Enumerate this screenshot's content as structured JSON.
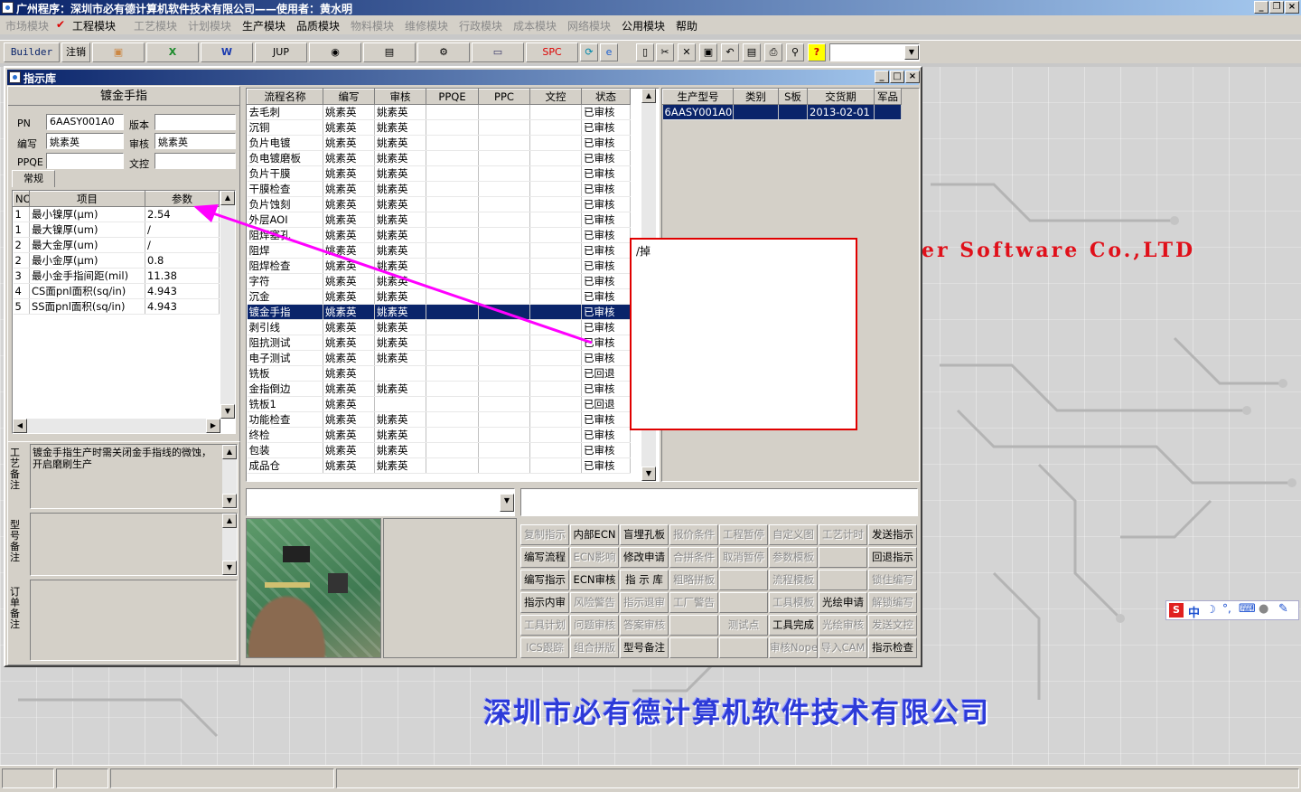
{
  "app": {
    "title": "广州程序：深圳市必有德计算机软件技术有限公司——使用者：黄水明",
    "background_tag": "er Software Co.,LTD",
    "background_company": "深圳市必有德计算机软件技术有限公司"
  },
  "menu": [
    {
      "label": "市场模块",
      "enabled": false
    },
    {
      "label": "工程模块",
      "enabled": true,
      "checked": true
    },
    {
      "label": "工艺模块",
      "enabled": false
    },
    {
      "label": "计划模块",
      "enabled": false
    },
    {
      "label": "生产模块",
      "enabled": true
    },
    {
      "label": "品质模块",
      "enabled": true
    },
    {
      "label": "物料模块",
      "enabled": false
    },
    {
      "label": "维修模块",
      "enabled": false
    },
    {
      "label": "行政模块",
      "enabled": false
    },
    {
      "label": "成本模块",
      "enabled": false
    },
    {
      "label": "网络模块",
      "enabled": false
    },
    {
      "label": "公用模块",
      "enabled": true
    },
    {
      "label": "帮助",
      "enabled": true
    }
  ],
  "toolbar": {
    "builder": "Builder",
    "logout": "注销",
    "jup": "JUP",
    "spc": "SPC",
    "help_glyph": "?"
  },
  "child": {
    "title": "指示库",
    "left": {
      "heading": "镀金手指",
      "pn_label": "PN",
      "pn_value": "6AASY001A0",
      "version_label": "版本",
      "version_value": "",
      "author_label": "编写",
      "author_value": "姚素英",
      "review_label": "审核",
      "review_value": "姚素英",
      "ppqe_label": "PPQE",
      "ppqe_value": "",
      "doc_label": "文控",
      "doc_value": "",
      "tab": "常规",
      "param_headers": [
        "NO",
        "项目",
        "参数"
      ],
      "params": [
        {
          "no": "1",
          "item": "最小镍厚(μm)",
          "value": "2.54"
        },
        {
          "no": "1",
          "item": "最大镍厚(um)",
          "value": "/"
        },
        {
          "no": "2",
          "item": "最大金厚(um)",
          "value": "/"
        },
        {
          "no": "2",
          "item": "最小金厚(μm)",
          "value": "0.8"
        },
        {
          "no": "3",
          "item": "最小金手指间距(mil)",
          "value": "11.38"
        },
        {
          "no": "4",
          "item": "CS面pnl面积(sq/in)",
          "value": "4.943"
        },
        {
          "no": "5",
          "item": "SS面pnl面积(sq/in)",
          "value": "4.943"
        }
      ],
      "craft_note_label": "工艺备注",
      "craft_note": "镀金手指生产时需关闭金手指线的微蚀，开启磨刷生产",
      "model_note_label": "型号备注",
      "order_note_label": "订单备注"
    },
    "process": {
      "headers": [
        "流程名称",
        "编写",
        "审核",
        "PPQE",
        "PPC",
        "文控",
        "状态"
      ],
      "rows": [
        {
          "name": "去毛刺",
          "author": "姚素英",
          "review": "姚素英",
          "status": "已审核"
        },
        {
          "name": "沉铜",
          "author": "姚素英",
          "review": "姚素英",
          "status": "已审核"
        },
        {
          "name": "负片电镀",
          "author": "姚素英",
          "review": "姚素英",
          "status": "已审核"
        },
        {
          "name": "负电镀磨板",
          "author": "姚素英",
          "review": "姚素英",
          "status": "已审核"
        },
        {
          "name": "负片干膜",
          "author": "姚素英",
          "review": "姚素英",
          "status": "已审核"
        },
        {
          "name": "干膜检查",
          "author": "姚素英",
          "review": "姚素英",
          "status": "已审核"
        },
        {
          "name": "负片蚀刻",
          "author": "姚素英",
          "review": "姚素英",
          "status": "已审核"
        },
        {
          "name": "外层AOI",
          "author": "姚素英",
          "review": "姚素英",
          "status": "已审核"
        },
        {
          "name": "阻焊塞孔",
          "author": "姚素英",
          "review": "姚素英",
          "status": "已审核"
        },
        {
          "name": "阻焊",
          "author": "姚素英",
          "review": "姚素英",
          "status": "已审核"
        },
        {
          "name": "阻焊检查",
          "author": "姚素英",
          "review": "姚素英",
          "status": "已审核"
        },
        {
          "name": "字符",
          "author": "姚素英",
          "review": "姚素英",
          "status": "已审核"
        },
        {
          "name": "沉金",
          "author": "姚素英",
          "review": "姚素英",
          "status": "已审核"
        },
        {
          "name": "镀金手指",
          "author": "姚素英",
          "review": "姚素英",
          "status": "已审核",
          "selected": true
        },
        {
          "name": "剥引线",
          "author": "姚素英",
          "review": "姚素英",
          "status": "已审核"
        },
        {
          "name": "阻抗测试",
          "author": "姚素英",
          "review": "姚素英",
          "status": "已审核"
        },
        {
          "name": "电子测试",
          "author": "姚素英",
          "review": "姚素英",
          "status": "已审核"
        },
        {
          "name": "铣板",
          "author": "姚素英",
          "review": "",
          "status": "已回退"
        },
        {
          "name": "金指倒边",
          "author": "姚素英",
          "review": "姚素英",
          "status": "已审核"
        },
        {
          "name": "铣板1",
          "author": "姚素英",
          "review": "",
          "status": "已回退"
        },
        {
          "name": "功能检查",
          "author": "姚素英",
          "review": "姚素英",
          "status": "已审核"
        },
        {
          "name": "终检",
          "author": "姚素英",
          "review": "姚素英",
          "status": "已审核"
        },
        {
          "name": "包装",
          "author": "姚素英",
          "review": "姚素英",
          "status": "已审核"
        },
        {
          "name": "成品仓",
          "author": "姚素英",
          "review": "姚素英",
          "status": "已审核"
        }
      ]
    },
    "popup_text": "/掉",
    "orders": {
      "headers": [
        "生产型号",
        "类别",
        "S板",
        "交货期",
        "军品"
      ],
      "rows": [
        {
          "model": "6AASY001A0",
          "type": "",
          "s": "",
          "date": "2013-02-01",
          "mil": ""
        }
      ]
    },
    "actions": [
      [
        {
          "l": "复制指示",
          "e": false
        },
        {
          "l": "内部ECN",
          "e": true
        },
        {
          "l": "盲埋孔板",
          "e": true
        },
        {
          "l": "报价条件",
          "e": false
        },
        {
          "l": "工程暂停",
          "e": false
        },
        {
          "l": "自定义图",
          "e": false
        },
        {
          "l": "工艺计时",
          "e": false
        },
        {
          "l": "发送指示",
          "e": true
        }
      ],
      [
        {
          "l": "编写流程",
          "e": true
        },
        {
          "l": "ECN影响",
          "e": false
        },
        {
          "l": "修改申请",
          "e": true
        },
        {
          "l": "合拼条件",
          "e": false
        },
        {
          "l": "取消暂停",
          "e": false
        },
        {
          "l": "参数模板",
          "e": false
        },
        {
          "l": "",
          "e": false
        },
        {
          "l": "回退指示",
          "e": true
        }
      ],
      [
        {
          "l": "编写指示",
          "e": true
        },
        {
          "l": "ECN审核",
          "e": true
        },
        {
          "l": "指 示 库",
          "e": true
        },
        {
          "l": "粗略拼板",
          "e": false
        },
        {
          "l": "",
          "e": false
        },
        {
          "l": "流程模板",
          "e": false
        },
        {
          "l": "",
          "e": false
        },
        {
          "l": "锁住编写",
          "e": false
        }
      ],
      [
        {
          "l": "指示内审",
          "e": true
        },
        {
          "l": "风险警告",
          "e": false
        },
        {
          "l": "指示退审",
          "e": false
        },
        {
          "l": "工厂警告",
          "e": false
        },
        {
          "l": "",
          "e": false
        },
        {
          "l": "工具模板",
          "e": false
        },
        {
          "l": "光绘申请",
          "e": true
        },
        {
          "l": "解锁编写",
          "e": false
        }
      ],
      [
        {
          "l": "工具计划",
          "e": false
        },
        {
          "l": "问题审核",
          "e": false
        },
        {
          "l": "答案审核",
          "e": false
        },
        {
          "l": "",
          "e": false
        },
        {
          "l": "测试点",
          "e": false
        },
        {
          "l": "工具完成",
          "e": true
        },
        {
          "l": "光绘审核",
          "e": false
        },
        {
          "l": "发送文控",
          "e": false
        }
      ],
      [
        {
          "l": "ICS跟踪",
          "e": false
        },
        {
          "l": "组合拼版",
          "e": false
        },
        {
          "l": "型号备注",
          "e": true
        },
        {
          "l": "",
          "e": false
        },
        {
          "l": "",
          "e": false
        },
        {
          "l": "审核Nope",
          "e": false
        },
        {
          "l": "导入CAM",
          "e": false
        },
        {
          "l": "指示检查",
          "e": true
        }
      ]
    ]
  },
  "ime": {
    "label": "中"
  },
  "colors": {
    "title_start": "#0a246a",
    "title_end": "#a6caf0",
    "selection": "#0a246a",
    "arrow": "#ff00ff",
    "popup_border": "#e00000"
  }
}
